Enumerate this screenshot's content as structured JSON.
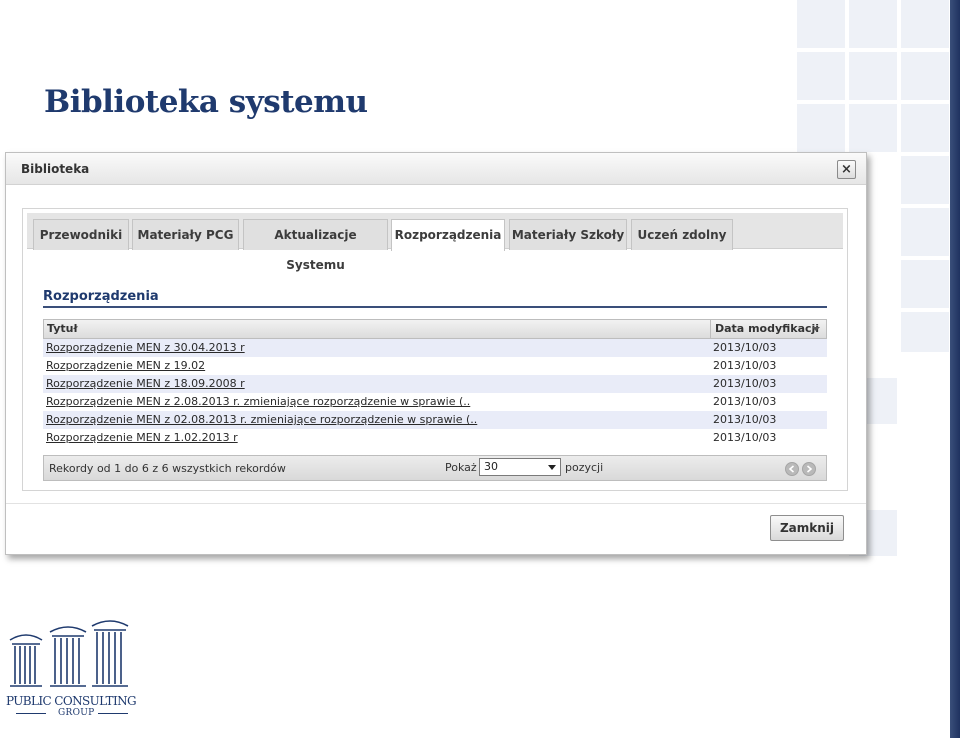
{
  "page": {
    "title": "Biblioteka systemu"
  },
  "dialog": {
    "title": "Biblioteka",
    "close_symbol": "×",
    "tabs": [
      {
        "label": "Przewodniki",
        "active": false
      },
      {
        "label": "Materiały PCG",
        "active": false
      },
      {
        "label": "Aktualizacje Systemu",
        "active": false
      },
      {
        "label": "Rozporządzenia",
        "active": true
      },
      {
        "label": "Materiały Szkoły",
        "active": false
      },
      {
        "label": "Uczeń zdolny",
        "active": false
      }
    ],
    "section_title": "Rozporządzenia",
    "table": {
      "columns": [
        "Tytuł",
        "Data modyfikacji"
      ],
      "rows": [
        {
          "title": "Rozporządzenie MEN z 30.04.2013 r",
          "date": "2013/10/03"
        },
        {
          "title": "Rozporządzenie MEN z 19.02",
          "date": "2013/10/03"
        },
        {
          "title": "Rozporządzenie MEN z 18.09.2008 r",
          "date": "2013/10/03"
        },
        {
          "title": "Rozporządzenie MEN z 2.08.2013 r. zmieniające rozporządzenie w sprawie (..",
          "date": "2013/10/03"
        },
        {
          "title": "Rozporządzenie MEN z 02.08.2013 r. zmieniające rozporządzenie w sprawie (..",
          "date": "2013/10/03"
        },
        {
          "title": "Rozporządzenie MEN z 1.02.2013 r",
          "date": "2013/10/03"
        }
      ]
    },
    "pager": {
      "records_text": "Rekordy od 1 do 6 z 6 wszystkich rekordów",
      "show_label": "Pokaż",
      "page_size": "30",
      "positions_label": "pozycji"
    },
    "close_button": "Zamknij"
  },
  "logo": {
    "line1": "PUBLIC CONSULTING",
    "line2": "GROUP"
  },
  "colors": {
    "title": "#1f3a6e",
    "row_alt": "#e9ecf8",
    "edge": "#1f3260"
  },
  "icons": [
    "close-icon",
    "sort-desc-icon",
    "select-arrow-icon",
    "prev-page-icon",
    "next-page-icon",
    "pcg-logo-columns-icon"
  ]
}
